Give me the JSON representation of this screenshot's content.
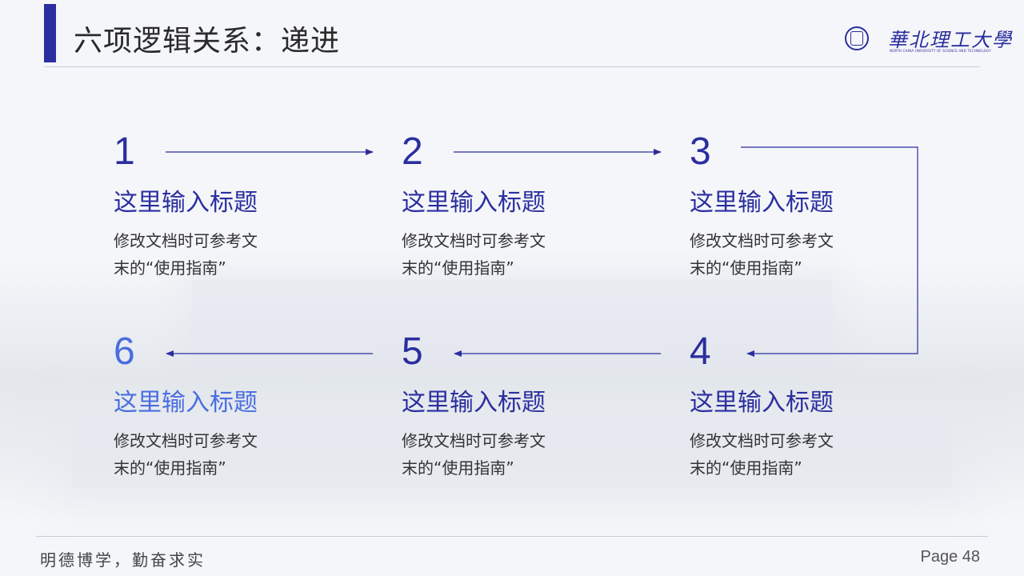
{
  "header": {
    "title": "六项逻辑关系：递进",
    "logo_text": "華北理工大學",
    "logo_subtext": "NORTH CHINA UNIVERSITY OF SCIENCE AND TECHNOLOGY"
  },
  "steps": [
    {
      "number": "1",
      "title": "这里输入标题",
      "desc_line1": "修改文档时可参考文",
      "desc_line2": "末的“使用指南”"
    },
    {
      "number": "2",
      "title": "这里输入标题",
      "desc_line1": "修改文档时可参考文",
      "desc_line2": "末的“使用指南”"
    },
    {
      "number": "3",
      "title": "这里输入标题",
      "desc_line1": "修改文档时可参考文",
      "desc_line2": "末的“使用指南”"
    },
    {
      "number": "4",
      "title": "这里输入标题",
      "desc_line1": "修改文档时可参考文",
      "desc_line2": "末的“使用指南”"
    },
    {
      "number": "5",
      "title": "这里输入标题",
      "desc_line1": "修改文档时可参考文",
      "desc_line2": "末的“使用指南”"
    },
    {
      "number": "6",
      "title": "这里输入标题",
      "desc_line1": "修改文档时可参考文",
      "desc_line2": "末的“使用指南”"
    }
  ],
  "footer": {
    "motto": "明德博学，勤奋求实",
    "page": "Page 48"
  },
  "colors": {
    "accent": "#2b2e9e",
    "highlight": "#4a6de0"
  }
}
